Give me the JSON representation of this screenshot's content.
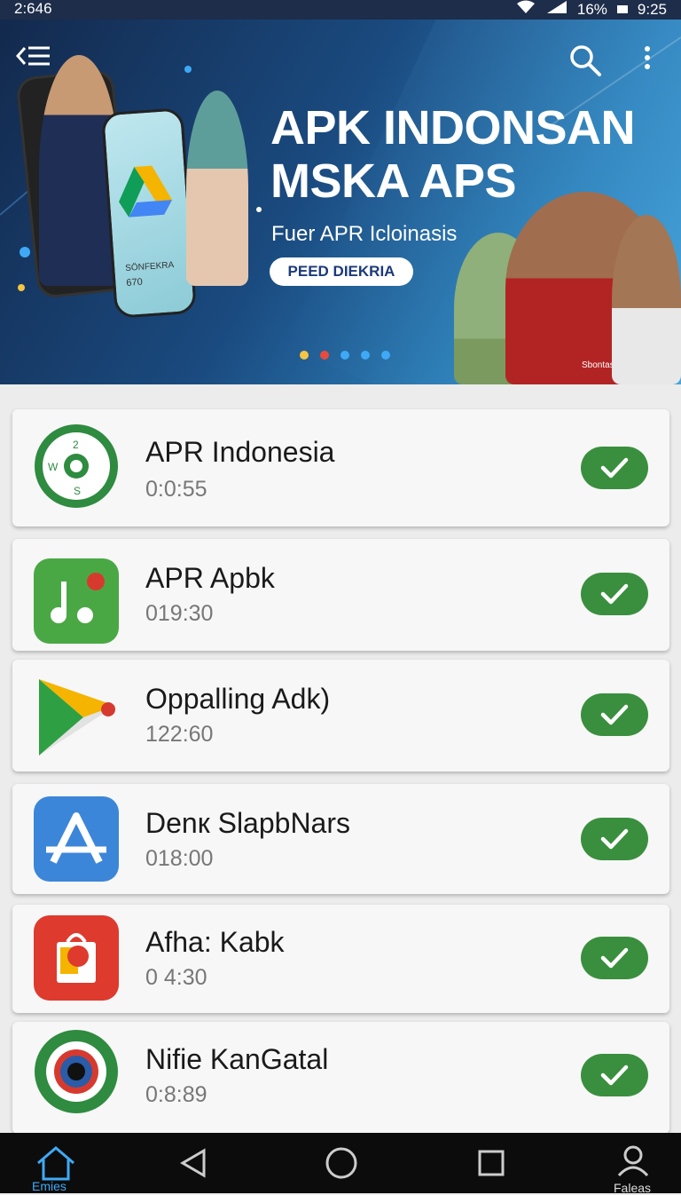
{
  "status": {
    "time": "2:646",
    "battery": "16%",
    "clock_right": "9:25"
  },
  "banner": {
    "title": "APK INDONSAN MSKA APS",
    "subtitle": "Fuer APR Icloinasis",
    "button_label": "PEED DIEKRIA",
    "phone_text": "SÖNFEKRA",
    "phone_code": "670",
    "shirt_text": "Sbontas",
    "dot_colors": [
      "#f5c542",
      "#e84b3c",
      "#3fa9f5",
      "#3fa9f5",
      "#3fa9f5"
    ]
  },
  "apps": [
    {
      "name": "APR Indonesia",
      "time": "0:0:55",
      "icon": "compass-icon"
    },
    {
      "name": "APR Apbk",
      "time": "019:30",
      "icon": "music-note-icon"
    },
    {
      "name": "Oppalling Adk)",
      "time": "122:60",
      "icon": "play-triangle-icon"
    },
    {
      "name": "Denк SlapbNars",
      "time": "018:00",
      "icon": "app-store-icon"
    },
    {
      "name": "Afha: Kabk",
      "time": "0 4:30",
      "icon": "shopping-bag-icon"
    },
    {
      "name": "Nifie KanGatal",
      "time": "0:8:89",
      "icon": "camera-lens-icon"
    }
  ],
  "nav": {
    "home_label": "Emies",
    "profile_label": "Faleas"
  },
  "colors": {
    "check_green": "#3a8f3e",
    "banner_dark": "#13294d"
  }
}
